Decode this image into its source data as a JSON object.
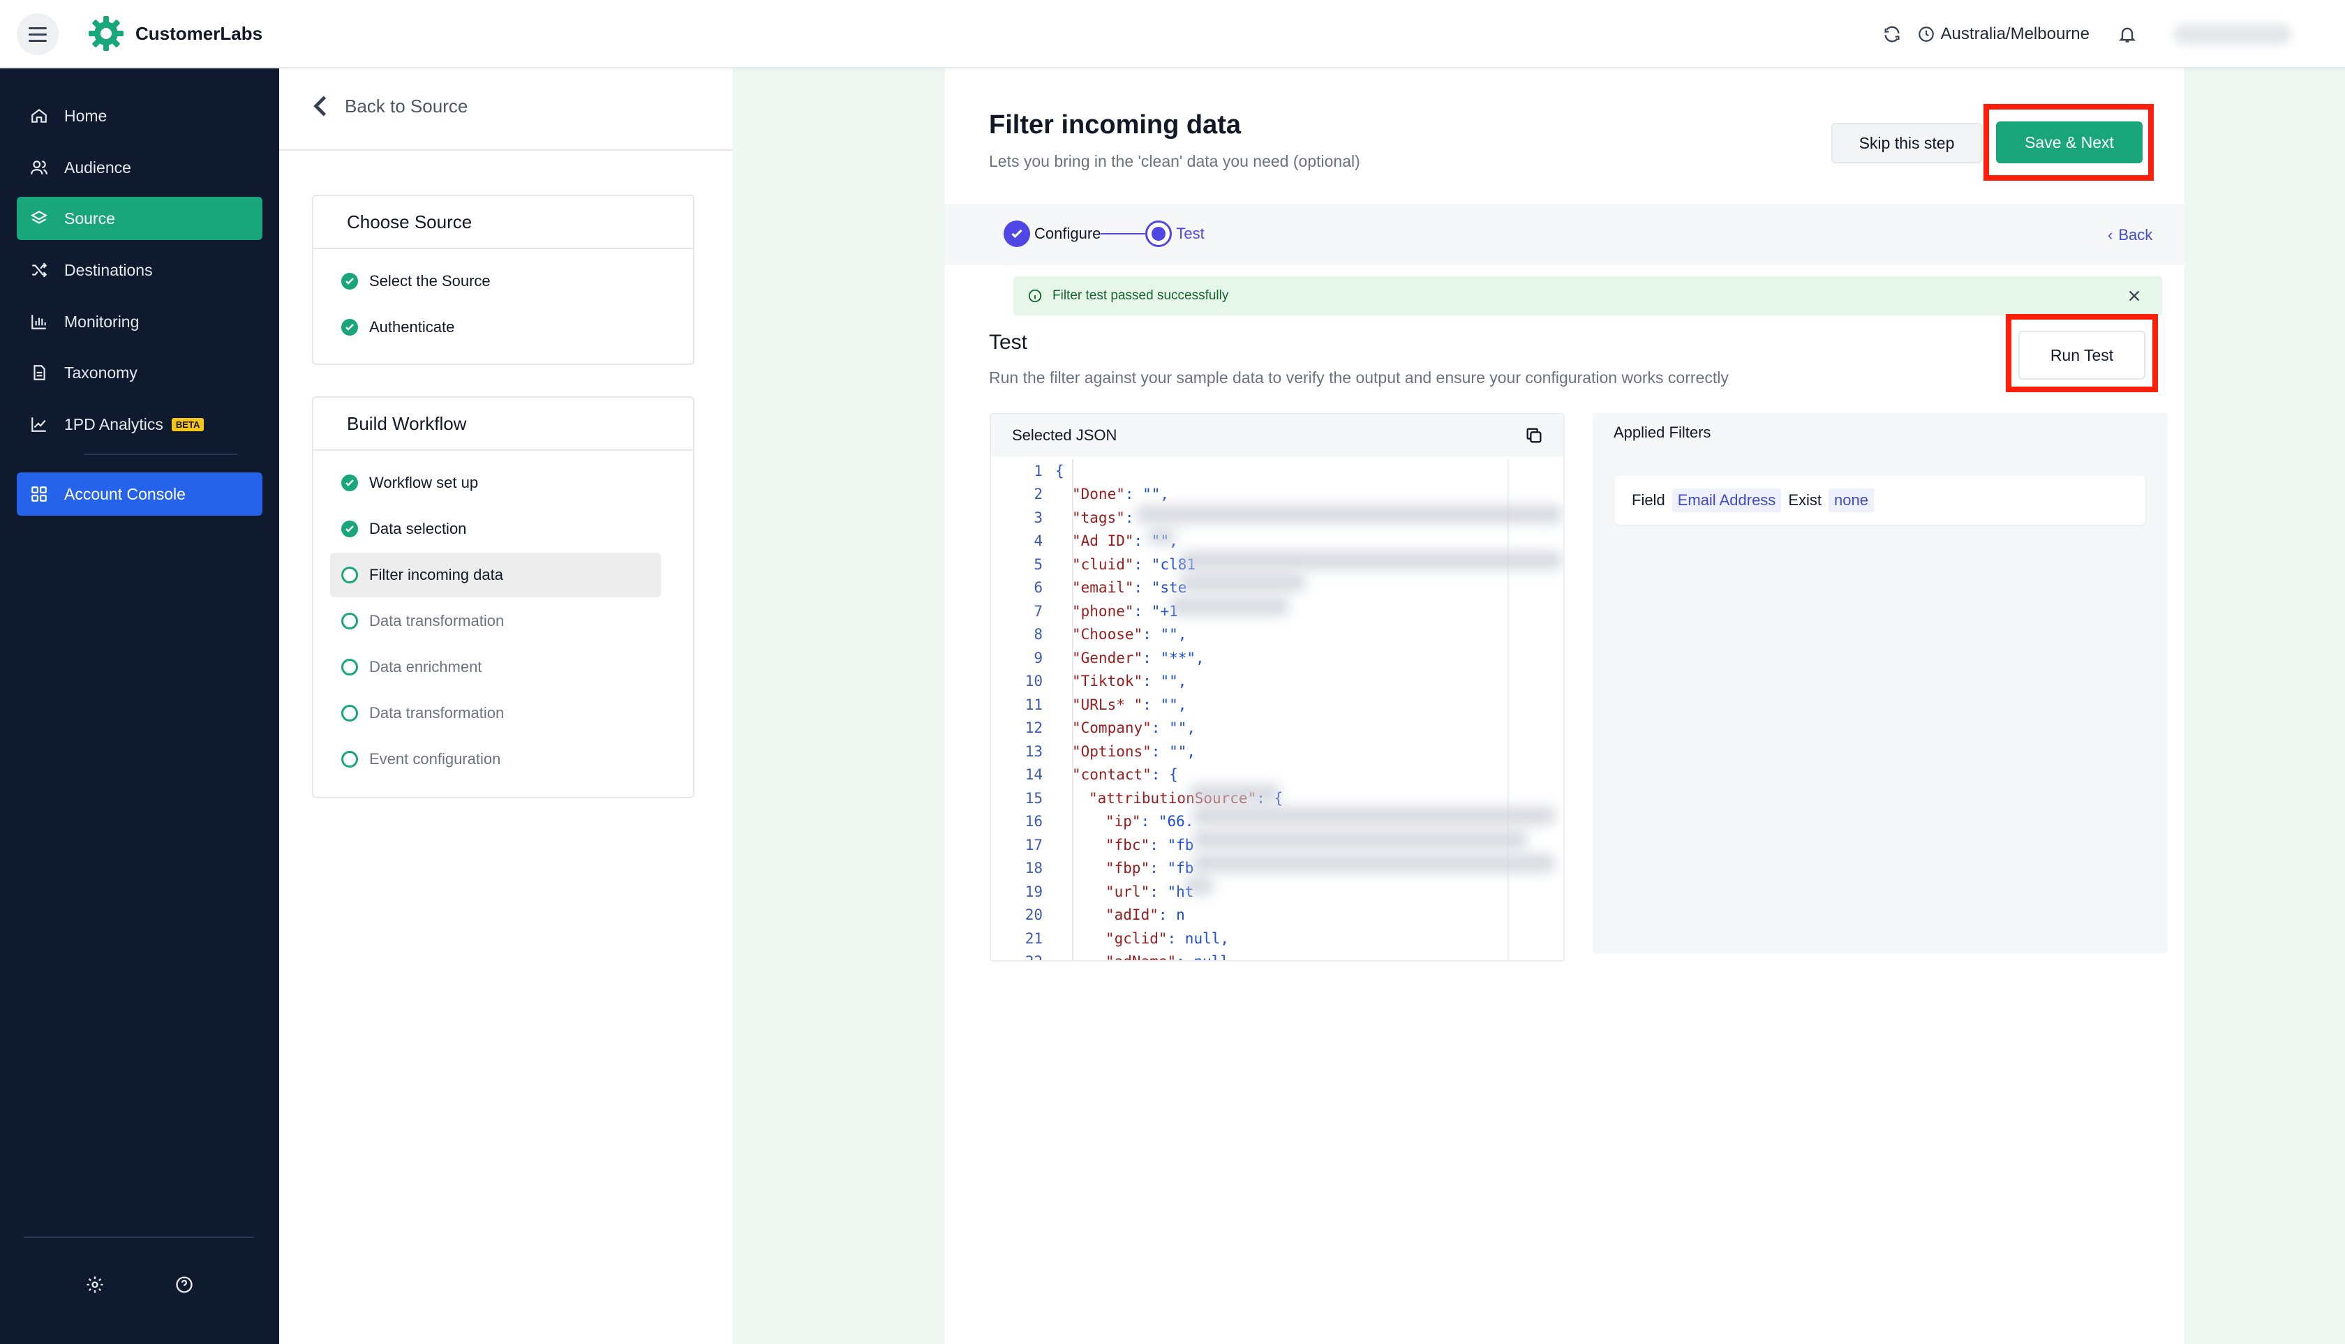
{
  "header": {
    "brand": "CustomerLabs",
    "timezone": "Australia/Melbourne"
  },
  "sidebar": {
    "items": [
      {
        "label": "Home",
        "icon": "home-icon"
      },
      {
        "label": "Audience",
        "icon": "users-icon"
      },
      {
        "label": "Source",
        "icon": "layers-icon"
      },
      {
        "label": "Destinations",
        "icon": "shuffle-icon"
      },
      {
        "label": "Monitoring",
        "icon": "bar-chart-icon"
      },
      {
        "label": "Taxonomy",
        "icon": "document-icon"
      },
      {
        "label": "1PD Analytics",
        "icon": "trend-chart-icon",
        "badge": "BETA"
      }
    ],
    "console_label": "Account Console",
    "active": "Source"
  },
  "steps": {
    "back_label": "Back to Source",
    "choose_title": "Choose Source",
    "choose_items": [
      "Select the Source",
      "Authenticate"
    ],
    "build_title": "Build Workflow",
    "build_items": [
      {
        "label": "Workflow set up",
        "state": "done"
      },
      {
        "label": "Data selection",
        "state": "done"
      },
      {
        "label": "Filter incoming data",
        "state": "current"
      },
      {
        "label": "Data transformation",
        "state": "pending"
      },
      {
        "label": "Data enrichment",
        "state": "pending"
      },
      {
        "label": "Data transformation",
        "state": "pending"
      },
      {
        "label": "Event configuration",
        "state": "pending"
      }
    ]
  },
  "main": {
    "title": "Filter incoming data",
    "subtitle": "Lets you bring in the 'clean' data you need (optional)",
    "skip_label": "Skip this step",
    "save_label": "Save & Next",
    "stepper": {
      "step1": "Configure",
      "step2": "Test",
      "back": "Back"
    },
    "alert": "Filter test passed successfully",
    "test_title": "Test",
    "test_desc": "Run the filter against your sample data to verify the output and ensure your configuration works correctly",
    "run_label": "Run Test",
    "json_title": "Selected JSON",
    "filters_title": "Applied Filters",
    "filter": {
      "field_word": "Field",
      "field": "Email Address",
      "op": "Exist",
      "value": "none"
    }
  },
  "json_lines": [
    {
      "n": "1",
      "indent": 0,
      "text": "{"
    },
    {
      "n": "2",
      "indent": 1,
      "key": "\"Done\"",
      "val": ": \"\","
    },
    {
      "n": "3",
      "indent": 1,
      "key": "\"tags\"",
      "val": ":"
    },
    {
      "n": "4",
      "indent": 1,
      "key": "\"Ad ID\"",
      "val": ": \"\","
    },
    {
      "n": "5",
      "indent": 1,
      "key": "\"cluid\"",
      "val": ": \"cl81"
    },
    {
      "n": "6",
      "indent": 1,
      "key": "\"email\"",
      "val": ": \"ste"
    },
    {
      "n": "7",
      "indent": 1,
      "key": "\"phone\"",
      "val": ": \"+1"
    },
    {
      "n": "8",
      "indent": 1,
      "key": "\"Choose\"",
      "val": ": \"\","
    },
    {
      "n": "9",
      "indent": 1,
      "key": "\"Gender\"",
      "val": ": \"**\","
    },
    {
      "n": "10",
      "indent": 1,
      "key": "\"Tiktok\"",
      "val": ": \"\","
    },
    {
      "n": "11",
      "indent": 1,
      "key": "\"URLs* \"",
      "val": ": \"\","
    },
    {
      "n": "12",
      "indent": 1,
      "key": "\"Company\"",
      "val": ": \"\","
    },
    {
      "n": "13",
      "indent": 1,
      "key": "\"Options\"",
      "val": ": \"\","
    },
    {
      "n": "14",
      "indent": 1,
      "key": "\"contact\"",
      "val": ": {"
    },
    {
      "n": "15",
      "indent": 2,
      "key": "\"attributionSource\"",
      "val": ": {"
    },
    {
      "n": "16",
      "indent": 3,
      "key": "\"ip\"",
      "val": ": \"66."
    },
    {
      "n": "17",
      "indent": 3,
      "key": "\"fbc\"",
      "val": ": \"fb"
    },
    {
      "n": "18",
      "indent": 3,
      "key": "\"fbp\"",
      "val": ": \"fb"
    },
    {
      "n": "19",
      "indent": 3,
      "key": "\"url\"",
      "val": ": \"ht"
    },
    {
      "n": "20",
      "indent": 3,
      "key": "\"adId\"",
      "val": ": n"
    },
    {
      "n": "21",
      "indent": 3,
      "key": "\"gclid\"",
      "val": ": null,"
    },
    {
      "n": "22",
      "indent": 3,
      "key": "\"adName\"",
      "val": ": null,"
    }
  ],
  "colors": {
    "sidebar_bg": "#0f1a2e",
    "accent_green": "#19a67b",
    "accent_blue": "#2563eb",
    "stepper_indigo": "#4f46e5",
    "highlight_red": "#ff1e0a"
  }
}
